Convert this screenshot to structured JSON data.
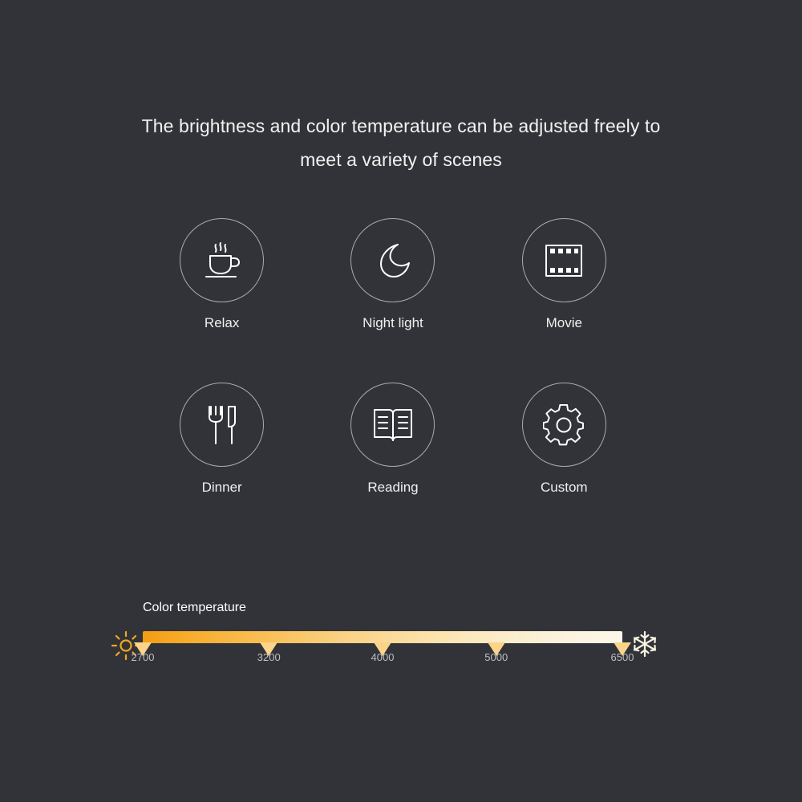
{
  "headline": {
    "line1": "The brightness and color temperature can be adjusted freely to",
    "line2": "meet a variety of scenes"
  },
  "scenes": [
    {
      "label": "Relax",
      "icon": "coffee-cup-icon"
    },
    {
      "label": "Night light",
      "icon": "crescent-moon-icon"
    },
    {
      "label": "Movie",
      "icon": "film-strip-icon"
    },
    {
      "label": "Dinner",
      "icon": "fork-knife-icon"
    },
    {
      "label": "Reading",
      "icon": "open-book-icon"
    },
    {
      "label": "Custom",
      "icon": "gear-icon"
    }
  ],
  "color_temperature": {
    "title": "Color temperature",
    "warm_icon": "sun-icon",
    "cool_icon": "snowflake-icon",
    "min_value": "2700",
    "max_value": "6500",
    "ticks": [
      {
        "label": "2700",
        "position_pct": 0
      },
      {
        "label": "3200",
        "position_pct": 26.3
      },
      {
        "label": "4000",
        "position_pct": 50.0
      },
      {
        "label": "5000",
        "position_pct": 73.7
      },
      {
        "label": "6500",
        "position_pct": 100
      }
    ],
    "gradient_start_color": "#f39c12",
    "gradient_end_color": "#fdf7e9",
    "warm_icon_color": "#f0a81e",
    "cool_icon_color": "#faf3e2"
  },
  "theme": {
    "background": "#313338",
    "text_color": "#f2f2f2",
    "circle_stroke": "#a9abad",
    "tick_color": "#bfbfbf"
  }
}
